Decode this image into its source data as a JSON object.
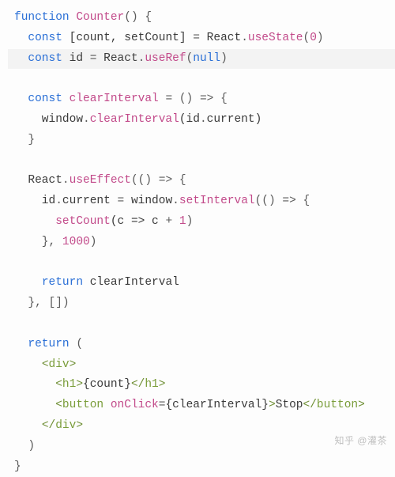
{
  "code": {
    "lines": [
      {
        "hl": false,
        "tokens": [
          {
            "t": "function ",
            "c": "kw"
          },
          {
            "t": "Counter",
            "c": "fn"
          },
          {
            "t": "() {",
            "c": "op"
          }
        ]
      },
      {
        "hl": false,
        "tokens": [
          {
            "t": "  ",
            "c": "id"
          },
          {
            "t": "const ",
            "c": "kw"
          },
          {
            "t": "[count, setCount] ",
            "c": "id"
          },
          {
            "t": "= ",
            "c": "op"
          },
          {
            "t": "React",
            "c": "id"
          },
          {
            "t": ".",
            "c": "op"
          },
          {
            "t": "useState",
            "c": "fn"
          },
          {
            "t": "(",
            "c": "op"
          },
          {
            "t": "0",
            "c": "num"
          },
          {
            "t": ")",
            "c": "op"
          }
        ]
      },
      {
        "hl": true,
        "tokens": [
          {
            "t": "  ",
            "c": "id"
          },
          {
            "t": "const ",
            "c": "kw"
          },
          {
            "t": "id ",
            "c": "id"
          },
          {
            "t": "= ",
            "c": "op"
          },
          {
            "t": "React",
            "c": "id"
          },
          {
            "t": ".",
            "c": "op"
          },
          {
            "t": "useRef",
            "c": "fn"
          },
          {
            "t": "(",
            "c": "op"
          },
          {
            "t": "null",
            "c": "str-ish"
          },
          {
            "t": ")",
            "c": "op"
          }
        ]
      },
      {
        "hl": false,
        "tokens": [
          {
            "t": "",
            "c": "id"
          }
        ]
      },
      {
        "hl": false,
        "tokens": [
          {
            "t": "  ",
            "c": "id"
          },
          {
            "t": "const ",
            "c": "kw"
          },
          {
            "t": "clearInterval ",
            "c": "fn"
          },
          {
            "t": "= () => {",
            "c": "op"
          }
        ]
      },
      {
        "hl": false,
        "tokens": [
          {
            "t": "    window",
            "c": "id"
          },
          {
            "t": ".",
            "c": "op"
          },
          {
            "t": "clearInterval",
            "c": "fn"
          },
          {
            "t": "(id",
            "c": "id"
          },
          {
            "t": ".",
            "c": "op"
          },
          {
            "t": "current)",
            "c": "id"
          }
        ]
      },
      {
        "hl": false,
        "tokens": [
          {
            "t": "  }",
            "c": "op"
          }
        ]
      },
      {
        "hl": false,
        "tokens": [
          {
            "t": "",
            "c": "id"
          }
        ]
      },
      {
        "hl": false,
        "tokens": [
          {
            "t": "  React",
            "c": "id"
          },
          {
            "t": ".",
            "c": "op"
          },
          {
            "t": "useEffect",
            "c": "fn"
          },
          {
            "t": "(() => {",
            "c": "op"
          }
        ]
      },
      {
        "hl": false,
        "tokens": [
          {
            "t": "    id",
            "c": "id"
          },
          {
            "t": ".",
            "c": "op"
          },
          {
            "t": "current ",
            "c": "id"
          },
          {
            "t": "= ",
            "c": "op"
          },
          {
            "t": "window",
            "c": "id"
          },
          {
            "t": ".",
            "c": "op"
          },
          {
            "t": "setInterval",
            "c": "fn"
          },
          {
            "t": "(() => {",
            "c": "op"
          }
        ]
      },
      {
        "hl": false,
        "tokens": [
          {
            "t": "      ",
            "c": "id"
          },
          {
            "t": "setCount",
            "c": "fn"
          },
          {
            "t": "(c => c ",
            "c": "id"
          },
          {
            "t": "+ ",
            "c": "op"
          },
          {
            "t": "1",
            "c": "num"
          },
          {
            "t": ")",
            "c": "op"
          }
        ]
      },
      {
        "hl": false,
        "tokens": [
          {
            "t": "    }, ",
            "c": "op"
          },
          {
            "t": "1000",
            "c": "num"
          },
          {
            "t": ")",
            "c": "op"
          }
        ]
      },
      {
        "hl": false,
        "tokens": [
          {
            "t": "",
            "c": "id"
          }
        ]
      },
      {
        "hl": false,
        "tokens": [
          {
            "t": "    ",
            "c": "id"
          },
          {
            "t": "return ",
            "c": "kw"
          },
          {
            "t": "clearInterval",
            "c": "id"
          }
        ]
      },
      {
        "hl": false,
        "tokens": [
          {
            "t": "  }, [])",
            "c": "op"
          }
        ]
      },
      {
        "hl": false,
        "tokens": [
          {
            "t": "",
            "c": "id"
          }
        ]
      },
      {
        "hl": false,
        "tokens": [
          {
            "t": "  ",
            "c": "id"
          },
          {
            "t": "return ",
            "c": "kw"
          },
          {
            "t": "(",
            "c": "op"
          }
        ]
      },
      {
        "hl": false,
        "tokens": [
          {
            "t": "    ",
            "c": "id"
          },
          {
            "t": "<",
            "c": "tagp"
          },
          {
            "t": "div",
            "c": "tag"
          },
          {
            "t": ">",
            "c": "tagp"
          }
        ]
      },
      {
        "hl": false,
        "tokens": [
          {
            "t": "      ",
            "c": "id"
          },
          {
            "t": "<",
            "c": "tagp"
          },
          {
            "t": "h1",
            "c": "tag"
          },
          {
            "t": ">",
            "c": "tagp"
          },
          {
            "t": "{count}",
            "c": "id"
          },
          {
            "t": "</",
            "c": "tagp"
          },
          {
            "t": "h1",
            "c": "tag"
          },
          {
            "t": ">",
            "c": "tagp"
          }
        ]
      },
      {
        "hl": false,
        "tokens": [
          {
            "t": "      ",
            "c": "id"
          },
          {
            "t": "<",
            "c": "tagp"
          },
          {
            "t": "button",
            "c": "tag"
          },
          {
            "t": " ",
            "c": "id"
          },
          {
            "t": "onClick",
            "c": "fn"
          },
          {
            "t": "=",
            "c": "op"
          },
          {
            "t": "{clearInterval}",
            "c": "id"
          },
          {
            "t": ">",
            "c": "tagp"
          },
          {
            "t": "Stop",
            "c": "id"
          },
          {
            "t": "</",
            "c": "tagp"
          },
          {
            "t": "button",
            "c": "tag"
          },
          {
            "t": ">",
            "c": "tagp"
          }
        ]
      },
      {
        "hl": false,
        "tokens": [
          {
            "t": "    ",
            "c": "id"
          },
          {
            "t": "</",
            "c": "tagp"
          },
          {
            "t": "div",
            "c": "tag"
          },
          {
            "t": ">",
            "c": "tagp"
          }
        ]
      },
      {
        "hl": false,
        "tokens": [
          {
            "t": "  )",
            "c": "op"
          }
        ]
      },
      {
        "hl": false,
        "tokens": [
          {
            "t": "}",
            "c": "op"
          }
        ]
      }
    ]
  },
  "watermark": "知乎 @灌茶"
}
